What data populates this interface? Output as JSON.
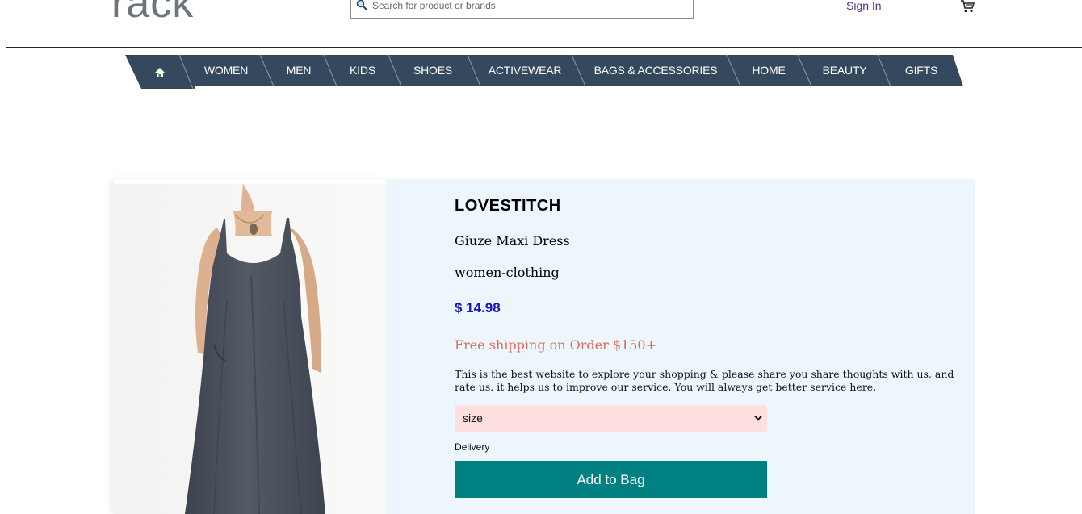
{
  "header": {
    "logo_text": "rack",
    "search_placeholder": "Search for product or brands",
    "sign_in_label": "Sign In"
  },
  "nav": {
    "items": [
      {
        "label": "WOMEN"
      },
      {
        "label": "MEN"
      },
      {
        "label": "KIDS"
      },
      {
        "label": "SHOES"
      },
      {
        "label": "ACTIVEWEAR"
      },
      {
        "label": "BAGS & ACCESSORIES"
      },
      {
        "label": "HOME"
      },
      {
        "label": "BEAUTY"
      },
      {
        "label": "GIFTS"
      }
    ],
    "bar_color": "#34495e"
  },
  "product": {
    "brand": "LOVESTITCH",
    "name": "Giuze Maxi Dress",
    "category": "women-clothing",
    "price": "$ 14.98",
    "shipping_note": "Free shipping on Order $150+",
    "description": "This is the best website to explore your shopping & please share you share thoughts with us, and rate us. it helps us to improve our service. You will always get better service here.",
    "size_select": "size",
    "delivery_label": "Delivery",
    "add_button": "Add to Bag",
    "image_icon": "dress-image"
  },
  "colors": {
    "accent": "#008080",
    "price": "#1515b8",
    "shipping": "#e06a5a",
    "info_bg": "#eef6fd",
    "size_bg": "#fde0df"
  }
}
